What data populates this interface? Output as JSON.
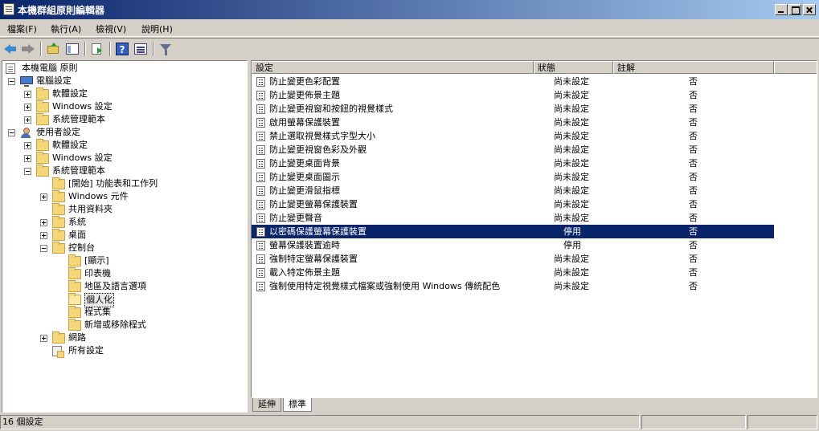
{
  "window": {
    "title": "本機群組原則編輯器"
  },
  "menu": [
    "檔案(F)",
    "執行(A)",
    "檢視(V)",
    "說明(H)"
  ],
  "tree": [
    {
      "label": "本機電腦 原則",
      "level": 0,
      "icon": "document-icon",
      "expander": ""
    },
    {
      "label": "電腦設定",
      "level": 1,
      "icon": "computer-icon",
      "expander": "minus"
    },
    {
      "label": "軟體設定",
      "level": 2,
      "icon": "folder-icon",
      "expander": "plus"
    },
    {
      "label": "Windows 設定",
      "level": 2,
      "icon": "folder-icon",
      "expander": "plus"
    },
    {
      "label": "系統管理範本",
      "level": 2,
      "icon": "folder-icon",
      "expander": "plus"
    },
    {
      "label": "使用者設定",
      "level": 1,
      "icon": "user-icon",
      "expander": "minus"
    },
    {
      "label": "軟體設定",
      "level": 2,
      "icon": "folder-icon",
      "expander": "plus"
    },
    {
      "label": "Windows 設定",
      "level": 2,
      "icon": "folder-icon",
      "expander": "plus"
    },
    {
      "label": "系統管理範本",
      "level": 2,
      "icon": "folder-icon",
      "expander": "minus"
    },
    {
      "label": "[開始] 功能表和工作列",
      "level": 3,
      "icon": "folder-icon",
      "expander": ""
    },
    {
      "label": "Windows 元件",
      "level": 3,
      "icon": "folder-icon",
      "expander": "plus"
    },
    {
      "label": "共用資料夾",
      "level": 3,
      "icon": "folder-icon",
      "expander": ""
    },
    {
      "label": "系統",
      "level": 3,
      "icon": "folder-icon",
      "expander": "plus"
    },
    {
      "label": "桌面",
      "level": 3,
      "icon": "folder-icon",
      "expander": "plus"
    },
    {
      "label": "控制台",
      "level": 3,
      "icon": "folder-icon",
      "expander": "minus"
    },
    {
      "label": "[顯示]",
      "level": 4,
      "icon": "folder-icon",
      "expander": ""
    },
    {
      "label": "印表機",
      "level": 4,
      "icon": "folder-icon",
      "expander": ""
    },
    {
      "label": "地區及語言選項",
      "level": 4,
      "icon": "folder-icon",
      "expander": ""
    },
    {
      "label": "個人化",
      "level": 4,
      "icon": "folder-icon",
      "expander": "",
      "selected": true
    },
    {
      "label": "程式集",
      "level": 4,
      "icon": "folder-icon",
      "expander": ""
    },
    {
      "label": "新增或移除程式",
      "level": 4,
      "icon": "folder-icon",
      "expander": ""
    },
    {
      "label": "網路",
      "level": 3,
      "icon": "folder-icon",
      "expander": "plus"
    },
    {
      "label": "所有設定",
      "level": 3,
      "icon": "all-settings-icon",
      "expander": ""
    }
  ],
  "list": {
    "columns": [
      "設定",
      "狀態",
      "註解"
    ],
    "rows": [
      {
        "setting": "防止變更色彩配置",
        "state": "尚未設定",
        "comment": "否"
      },
      {
        "setting": "防止變更佈景主題",
        "state": "尚未設定",
        "comment": "否"
      },
      {
        "setting": "防止變更視窗和按鈕的視覺樣式",
        "state": "尚未設定",
        "comment": "否"
      },
      {
        "setting": "啟用螢幕保護裝置",
        "state": "尚未設定",
        "comment": "否"
      },
      {
        "setting": "禁止選取視覺樣式字型大小",
        "state": "尚未設定",
        "comment": "否"
      },
      {
        "setting": "防止變更視窗色彩及外觀",
        "state": "尚未設定",
        "comment": "否"
      },
      {
        "setting": "防止變更桌面背景",
        "state": "尚未設定",
        "comment": "否"
      },
      {
        "setting": "防止變更桌面圖示",
        "state": "尚未設定",
        "comment": "否"
      },
      {
        "setting": "防止變更滑鼠指標",
        "state": "尚未設定",
        "comment": "否"
      },
      {
        "setting": "防止變更螢幕保護裝置",
        "state": "尚未設定",
        "comment": "否"
      },
      {
        "setting": "防止變更聲音",
        "state": "尚未設定",
        "comment": "否"
      },
      {
        "setting": "以密碼保護螢幕保護裝置",
        "state": "停用",
        "comment": "否",
        "selected": true
      },
      {
        "setting": "螢幕保護裝置逾時",
        "state": "停用",
        "comment": "否"
      },
      {
        "setting": "強制特定螢幕保護裝置",
        "state": "尚未設定",
        "comment": "否"
      },
      {
        "setting": "載入特定佈景主題",
        "state": "尚未設定",
        "comment": "否"
      },
      {
        "setting": "強制使用特定視覺樣式檔案或強制使用 Windows 傳統配色",
        "state": "尚未設定",
        "comment": "否"
      }
    ]
  },
  "tabs": [
    {
      "label": "延伸",
      "active": false
    },
    {
      "label": "標準",
      "active": true
    }
  ],
  "status": {
    "text": "16 個設定"
  },
  "colors": {
    "selection": "#0a246a",
    "titlebar_start": "#0a246a",
    "titlebar_end": "#a6caf0"
  }
}
